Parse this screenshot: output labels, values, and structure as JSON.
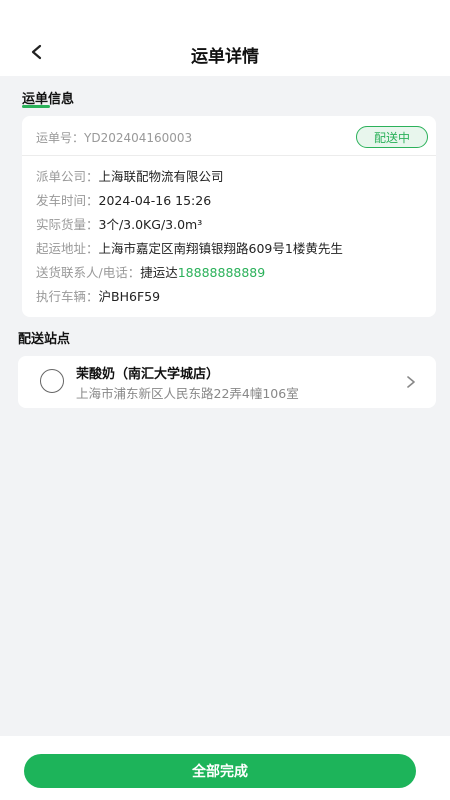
{
  "header": {
    "title": "运单详情",
    "back_icon": "chevron-left-icon"
  },
  "waybill_info": {
    "section_title": "运单信息",
    "waybill_no": "运单号：YD202404160003",
    "status": "配送中",
    "rows": [
      {
        "label": "派单公司：",
        "value": "上海联配物流有限公司"
      },
      {
        "label": "发车时间：",
        "value": "2024-04-16 15:26"
      },
      {
        "label": "实际货量：",
        "value": "3个/3.0KG/3.0m³"
      },
      {
        "label": "起运地址：",
        "value": "上海市嘉定区南翔镇银翔路609号1楼黄先生"
      },
      {
        "label": "送货联系人/电话：",
        "value": "捷运达",
        "phone": "18888888889"
      },
      {
        "label": "执行车辆：",
        "value": "沪BH6F59"
      }
    ]
  },
  "stops": {
    "section_title": "配送站点",
    "items": [
      {
        "name": "茉酸奶（南汇大学城店）",
        "address": "上海市浦东新区人民东路22弄4幢106室"
      }
    ]
  },
  "footer": {
    "complete_label": "全部完成"
  },
  "colors": {
    "accent": "#1db45a",
    "background": "#f2f3f5",
    "badge_bg": "#e8f6ed"
  }
}
